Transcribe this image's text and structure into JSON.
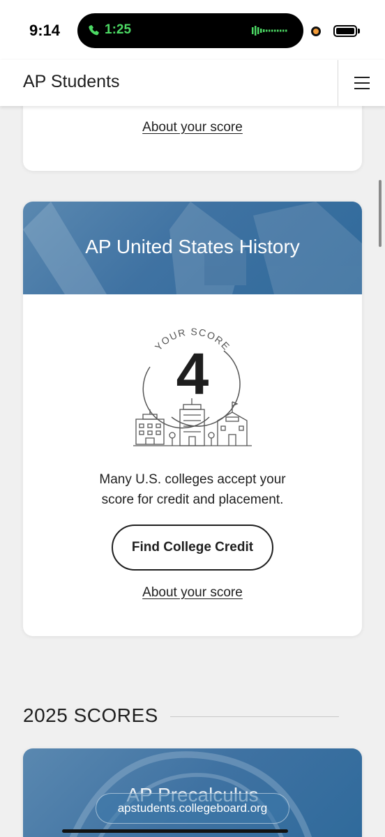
{
  "status_bar": {
    "time": "9:14",
    "call_duration": "1:25",
    "call_color": "#4cd964",
    "phone_icon": "phone-icon",
    "battery_icon": "battery-icon"
  },
  "header": {
    "title": "AP Students",
    "menu_icon": "hamburger-menu-icon"
  },
  "cards": {
    "previous": {
      "about_link": "About your score"
    },
    "ush": {
      "title": "AP United States History",
      "score_caption": "YOUR SCORE",
      "score": "4",
      "message_line1": "Many U.S. colleges accept your",
      "message_line2": "score for credit and placement.",
      "cta_label": "Find College Credit",
      "about_link": "About your score",
      "banner_color": "#3f72a2"
    },
    "next": {
      "title": "AP Precalculus"
    }
  },
  "section": {
    "heading": "2025 SCORES"
  },
  "browser": {
    "url": "apstudents.collegeboard.org"
  }
}
